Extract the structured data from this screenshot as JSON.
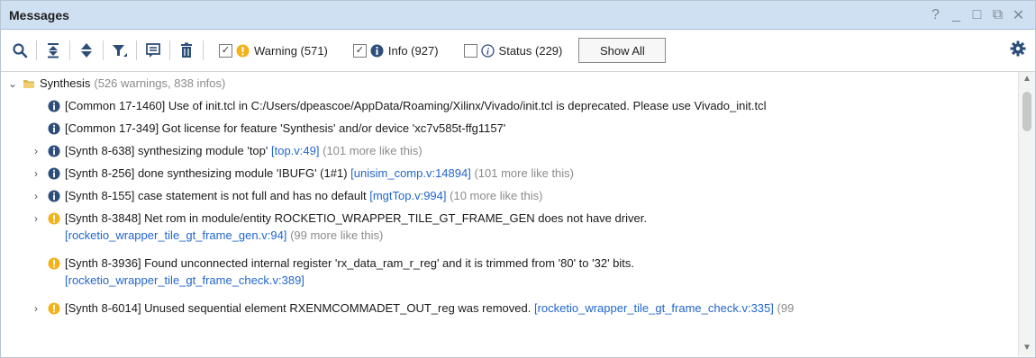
{
  "window": {
    "title": "Messages",
    "controls": [
      "?",
      "_",
      "□",
      "⧉",
      "✕"
    ]
  },
  "toolbar": {
    "icons": [
      "search-icon",
      "collapse-all-icon",
      "expand-all-icon",
      "filter-icon",
      "group-icon",
      "delete-icon"
    ],
    "filters": {
      "warning": {
        "label": "Warning (571)",
        "checked": true
      },
      "info": {
        "label": "Info (927)",
        "checked": true
      },
      "status": {
        "label": "Status (229)",
        "checked": false
      }
    },
    "show_all_label": "Show All"
  },
  "colors": {
    "warning": "#f2b21a",
    "info": "#2d4e7a",
    "link": "#2266cc",
    "titlebar": "#cfe0f3"
  },
  "tree": {
    "group": {
      "label": "Synthesis",
      "summary": "(526 warnings, 838 infos)"
    },
    "messages": [
      {
        "type": "info",
        "expandable": false,
        "text": "[Common 17-1460] Use of init.tcl in C:/Users/dpeascoe/AppData/Roaming/Xilinx/Vivado/init.tcl is deprecated. Please use Vivado_init.tcl"
      },
      {
        "type": "info",
        "expandable": false,
        "text": "[Common 17-349] Got license for feature 'Synthesis' and/or device 'xc7v585t-ffg1157'"
      },
      {
        "type": "info",
        "expandable": true,
        "text": "[Synth 8-638] synthesizing module 'top'",
        "link": "[top.v:49]",
        "more": "(101 more like this)"
      },
      {
        "type": "info",
        "expandable": true,
        "text": "[Synth 8-256] done synthesizing module 'IBUFG' (1#1)",
        "link": "[unisim_comp.v:14894]",
        "more": "(101 more like this)"
      },
      {
        "type": "info",
        "expandable": true,
        "text": "[Synth 8-155] case statement is not full and has no default",
        "link": "[mgtTop.v:994]",
        "more": "(10 more like this)"
      },
      {
        "type": "warning",
        "expandable": true,
        "text": "[Synth 8-3848] Net rom in module/entity ROCKETIO_WRAPPER_TILE_GT_FRAME_GEN does not have driver.",
        "link": "[rocketio_wrapper_tile_gt_frame_gen.v:94]",
        "more": "(99 more like this)"
      },
      {
        "type": "warning",
        "expandable": false,
        "text": "[Synth 8-3936] Found unconnected internal register 'rx_data_ram_r_reg' and it is trimmed from '80' to '32' bits.",
        "link": "[rocketio_wrapper_tile_gt_frame_check.v:389]",
        "more": ""
      },
      {
        "type": "warning",
        "expandable": true,
        "text": "[Synth 8-6014] Unused sequential element RXENMCOMMADET_OUT_reg was removed.",
        "link": "[rocketio_wrapper_tile_gt_frame_check.v:335]",
        "more": "(99"
      }
    ]
  }
}
